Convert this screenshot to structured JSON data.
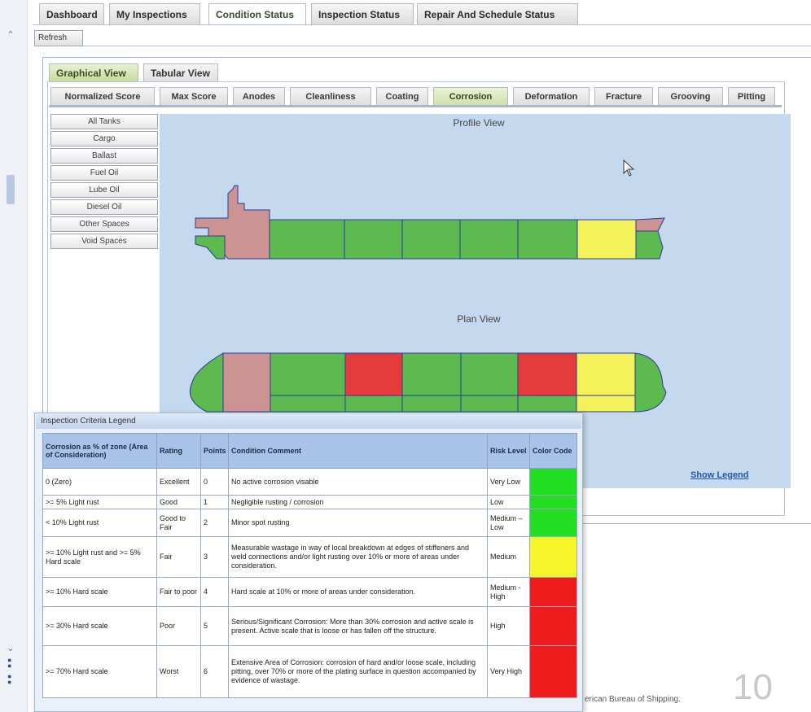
{
  "top_tabs": [
    "Dashboard",
    "My Inspections",
    "Condition Status",
    "Inspection Status",
    "Repair And Schedule Status"
  ],
  "refresh_label": "Refresh",
  "view_tabs": [
    "Graphical View",
    "Tabular View"
  ],
  "category_tabs": [
    "Normalized Score",
    "Max Score",
    "Anodes",
    "Cleanliness",
    "Coating",
    "Corrosion",
    "Deformation",
    "Fracture",
    "Grooving",
    "Pitting"
  ],
  "tank_filters": [
    "All Tanks",
    "Cargo",
    "Ballast",
    "Fuel Oil",
    "Lube Oil",
    "Diesel Oil",
    "Other Spaces",
    "Void Spaces"
  ],
  "profile_view_title": "Profile View",
  "plan_view_title": "Plan View",
  "show_legend_label": "Show Legend",
  "colors": {
    "green": "#5cba4f",
    "red": "#e53b3b",
    "yellow": "#f4f25a",
    "mauve": "#cc9393",
    "outline": "#2a3a9a"
  },
  "legend": {
    "title": "Inspection Criteria Legend",
    "headers": [
      "Corrosion as % of zone (Area of Consideration)",
      "Rating",
      "Points",
      "Condition Comment",
      "Risk Level",
      "Color Code"
    ],
    "rows": [
      {
        "corrosion": "0 (Zero)",
        "rating": "Excellent",
        "points": "0",
        "comment": "No active corrosion visable",
        "risk": "Very Low",
        "color": "#22dd22"
      },
      {
        "corrosion": ">= 5% Light rust",
        "rating": "Good",
        "points": "1",
        "comment": "Negligible rusting / corrosion",
        "risk": "Low",
        "color": "#22dd22"
      },
      {
        "corrosion": "< 10% Light rust",
        "rating": "Good to Fair",
        "points": "2",
        "comment": "Minor spot rusting",
        "risk": "Medium – Low",
        "color": "#22dd22"
      },
      {
        "corrosion": ">= 10% Light rust and >= 5% Hard scale",
        "rating": "Fair",
        "points": "3",
        "comment": "Measurable wastage in way of local breakdown at edges of stiffeners and weld connections and/or light rusting over 10% or more of areas under consideration.",
        "risk": "Medium",
        "color": "#f5f52a"
      },
      {
        "corrosion": ">= 10% Hard scale",
        "rating": "Fair to poor",
        "points": "4",
        "comment": "Hard scale at 10% or more of areas under consideration.",
        "risk": "Medium - High",
        "color": "#ee1c1c"
      },
      {
        "corrosion": ">= 30% Hard scale",
        "rating": "Poor",
        "points": "5",
        "comment": "Serious/Significant Corrosion: More than 30% corrosion and active scale is present. Active scale that is loose or has fallen off the structure.",
        "risk": "High",
        "color": "#ee1c1c"
      },
      {
        "corrosion": ">= 70% Hard scale",
        "rating": "Worst",
        "points": "6",
        "comment": "Extensive Area of Corrosion: corrosion of hard and/or loose scale, including pitting, over 70% or more of the plating surface in question accompanied by evidence of wastage.",
        "risk": "Very High",
        "color": "#ee1c1c"
      }
    ]
  },
  "slide_number": "10",
  "footer_text": "erican Bureau of Shipping."
}
